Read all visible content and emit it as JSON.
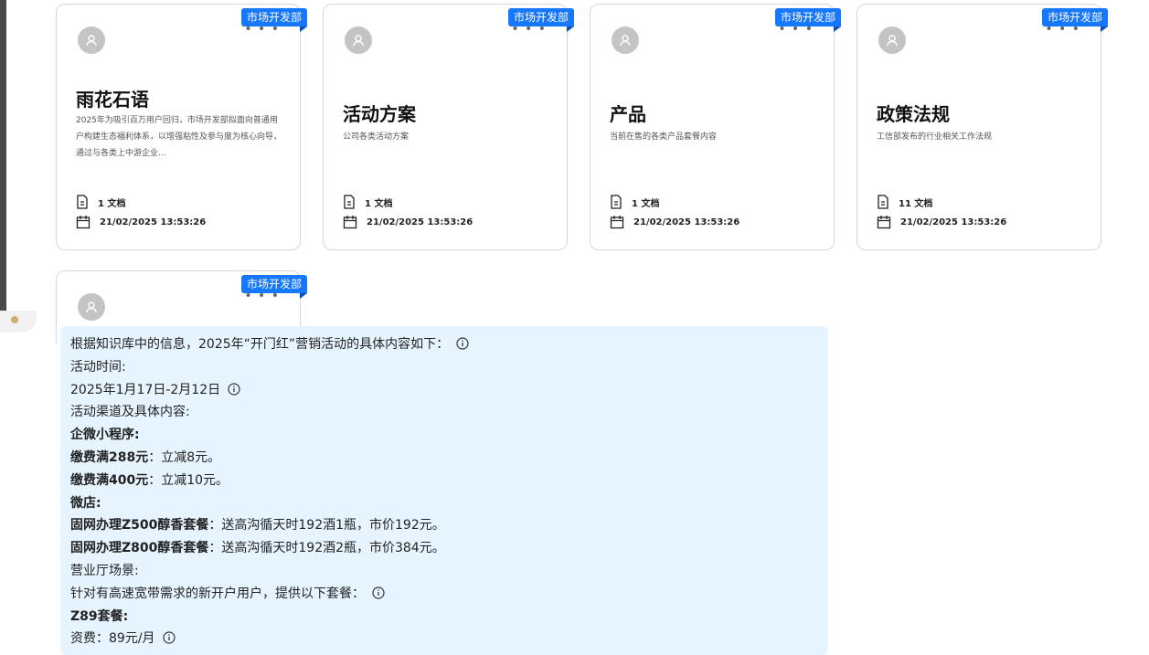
{
  "cards": [
    {
      "tag": "市场开发部",
      "title": "雨花石语",
      "desc": "2025年为吸引百万用户回归，市场开发部拟面向普通用户构建生态福利体系，以增强粘性及参与度为核心向导，通过与各类上中游企业...",
      "docs": "1 文档",
      "date": "21/02/2025 13:53:26"
    },
    {
      "tag": "市场开发部",
      "title": "活动方案",
      "desc": "公司各类活动方案",
      "docs": "1 文档",
      "date": "21/02/2025 13:53:26"
    },
    {
      "tag": "市场开发部",
      "title": "产品",
      "desc": "当前在售的各类产品套餐内容",
      "docs": "1 文档",
      "date": "21/02/2025 13:53:26"
    },
    {
      "tag": "市场开发部",
      "title": "政策法规",
      "desc": "工信部发布的行业相关工作法规",
      "docs": "11 文档",
      "date": "21/02/2025 13:53:26"
    },
    {
      "tag": "市场开发部"
    }
  ],
  "answer": {
    "l1": "根据知识库中的信息，2025年“开门红”营销活动的具体内容如下：",
    "l2": "活动时间:",
    "l3": "2025年1月17日-2月12日",
    "l4": "活动渠道及具体内容:",
    "l5": "企微小程序:",
    "l6b": "缴费满288元",
    "l6": "：立减8元。",
    "l7b": "缴费满400元",
    "l7": "：立减10元。",
    "l8": "微店:",
    "l9b": "固网办理Z500醇香套餐",
    "l9": "：送高沟循天时192酒1瓶，市价192元。",
    "l10b": "固网办理Z800醇香套餐",
    "l10": "：送高沟循天时192酒2瓶，市价384元。",
    "l11": "营业厅场景:",
    "l12": "针对有高速宽带需求的新开户用户，提供以下套餐：",
    "l13": "Z89套餐:",
    "l14": "资费：89元/月"
  },
  "icons": {
    "more": "more-dots-icon",
    "avatar": "user-icon",
    "doc": "document-icon",
    "calendar": "calendar-icon",
    "info": "info-icon"
  },
  "colors": {
    "tag": "#1677ff",
    "chat_bg": "#e6f4ff"
  }
}
